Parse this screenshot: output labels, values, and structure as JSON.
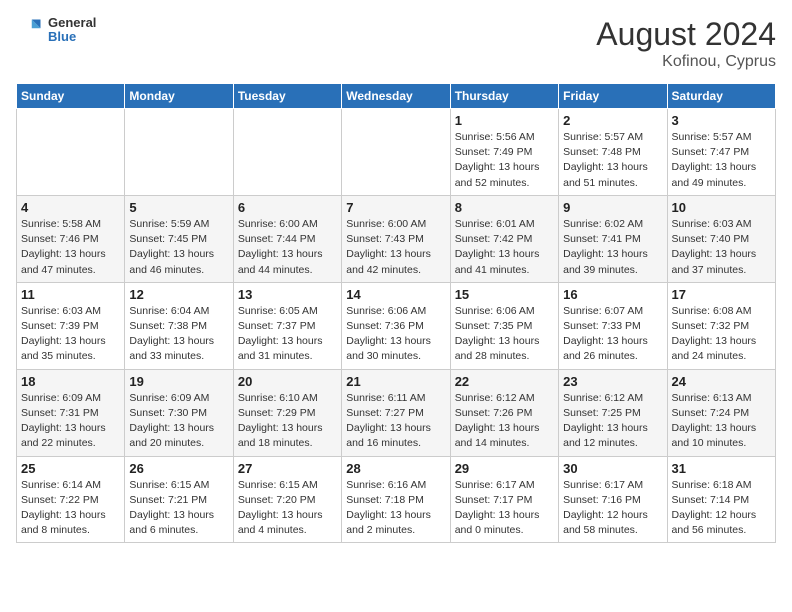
{
  "header": {
    "logo_general": "General",
    "logo_blue": "Blue",
    "main_title": "August 2024",
    "subtitle": "Kofinou, Cyprus"
  },
  "days_of_week": [
    "Sunday",
    "Monday",
    "Tuesday",
    "Wednesday",
    "Thursday",
    "Friday",
    "Saturday"
  ],
  "weeks": [
    [
      {
        "num": "",
        "info": ""
      },
      {
        "num": "",
        "info": ""
      },
      {
        "num": "",
        "info": ""
      },
      {
        "num": "",
        "info": ""
      },
      {
        "num": "1",
        "info": "Sunrise: 5:56 AM\nSunset: 7:49 PM\nDaylight: 13 hours\nand 52 minutes."
      },
      {
        "num": "2",
        "info": "Sunrise: 5:57 AM\nSunset: 7:48 PM\nDaylight: 13 hours\nand 51 minutes."
      },
      {
        "num": "3",
        "info": "Sunrise: 5:57 AM\nSunset: 7:47 PM\nDaylight: 13 hours\nand 49 minutes."
      }
    ],
    [
      {
        "num": "4",
        "info": "Sunrise: 5:58 AM\nSunset: 7:46 PM\nDaylight: 13 hours\nand 47 minutes."
      },
      {
        "num": "5",
        "info": "Sunrise: 5:59 AM\nSunset: 7:45 PM\nDaylight: 13 hours\nand 46 minutes."
      },
      {
        "num": "6",
        "info": "Sunrise: 6:00 AM\nSunset: 7:44 PM\nDaylight: 13 hours\nand 44 minutes."
      },
      {
        "num": "7",
        "info": "Sunrise: 6:00 AM\nSunset: 7:43 PM\nDaylight: 13 hours\nand 42 minutes."
      },
      {
        "num": "8",
        "info": "Sunrise: 6:01 AM\nSunset: 7:42 PM\nDaylight: 13 hours\nand 41 minutes."
      },
      {
        "num": "9",
        "info": "Sunrise: 6:02 AM\nSunset: 7:41 PM\nDaylight: 13 hours\nand 39 minutes."
      },
      {
        "num": "10",
        "info": "Sunrise: 6:03 AM\nSunset: 7:40 PM\nDaylight: 13 hours\nand 37 minutes."
      }
    ],
    [
      {
        "num": "11",
        "info": "Sunrise: 6:03 AM\nSunset: 7:39 PM\nDaylight: 13 hours\nand 35 minutes."
      },
      {
        "num": "12",
        "info": "Sunrise: 6:04 AM\nSunset: 7:38 PM\nDaylight: 13 hours\nand 33 minutes."
      },
      {
        "num": "13",
        "info": "Sunrise: 6:05 AM\nSunset: 7:37 PM\nDaylight: 13 hours\nand 31 minutes."
      },
      {
        "num": "14",
        "info": "Sunrise: 6:06 AM\nSunset: 7:36 PM\nDaylight: 13 hours\nand 30 minutes."
      },
      {
        "num": "15",
        "info": "Sunrise: 6:06 AM\nSunset: 7:35 PM\nDaylight: 13 hours\nand 28 minutes."
      },
      {
        "num": "16",
        "info": "Sunrise: 6:07 AM\nSunset: 7:33 PM\nDaylight: 13 hours\nand 26 minutes."
      },
      {
        "num": "17",
        "info": "Sunrise: 6:08 AM\nSunset: 7:32 PM\nDaylight: 13 hours\nand 24 minutes."
      }
    ],
    [
      {
        "num": "18",
        "info": "Sunrise: 6:09 AM\nSunset: 7:31 PM\nDaylight: 13 hours\nand 22 minutes."
      },
      {
        "num": "19",
        "info": "Sunrise: 6:09 AM\nSunset: 7:30 PM\nDaylight: 13 hours\nand 20 minutes."
      },
      {
        "num": "20",
        "info": "Sunrise: 6:10 AM\nSunset: 7:29 PM\nDaylight: 13 hours\nand 18 minutes."
      },
      {
        "num": "21",
        "info": "Sunrise: 6:11 AM\nSunset: 7:27 PM\nDaylight: 13 hours\nand 16 minutes."
      },
      {
        "num": "22",
        "info": "Sunrise: 6:12 AM\nSunset: 7:26 PM\nDaylight: 13 hours\nand 14 minutes."
      },
      {
        "num": "23",
        "info": "Sunrise: 6:12 AM\nSunset: 7:25 PM\nDaylight: 13 hours\nand 12 minutes."
      },
      {
        "num": "24",
        "info": "Sunrise: 6:13 AM\nSunset: 7:24 PM\nDaylight: 13 hours\nand 10 minutes."
      }
    ],
    [
      {
        "num": "25",
        "info": "Sunrise: 6:14 AM\nSunset: 7:22 PM\nDaylight: 13 hours\nand 8 minutes."
      },
      {
        "num": "26",
        "info": "Sunrise: 6:15 AM\nSunset: 7:21 PM\nDaylight: 13 hours\nand 6 minutes."
      },
      {
        "num": "27",
        "info": "Sunrise: 6:15 AM\nSunset: 7:20 PM\nDaylight: 13 hours\nand 4 minutes."
      },
      {
        "num": "28",
        "info": "Sunrise: 6:16 AM\nSunset: 7:18 PM\nDaylight: 13 hours\nand 2 minutes."
      },
      {
        "num": "29",
        "info": "Sunrise: 6:17 AM\nSunset: 7:17 PM\nDaylight: 13 hours\nand 0 minutes."
      },
      {
        "num": "30",
        "info": "Sunrise: 6:17 AM\nSunset: 7:16 PM\nDaylight: 12 hours\nand 58 minutes."
      },
      {
        "num": "31",
        "info": "Sunrise: 6:18 AM\nSunset: 7:14 PM\nDaylight: 12 hours\nand 56 minutes."
      }
    ]
  ]
}
